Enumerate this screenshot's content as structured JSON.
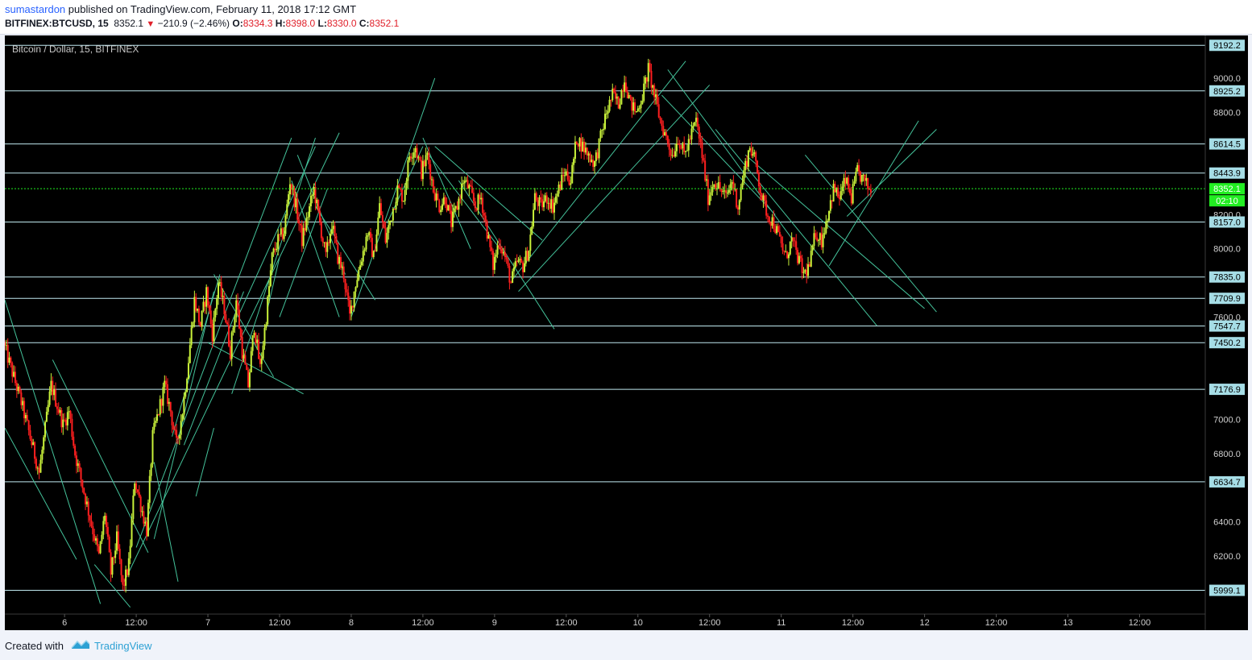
{
  "header": {
    "author": "sumastardon",
    "published_text": "published on TradingView.com, February 11, 2018 17:12 GMT",
    "symbol": "BITFINEX:BTCUSD, 15",
    "last_price": "8352.1",
    "change": "−210.9 (−2.46%)",
    "open_label": "O:",
    "open": "8334.3",
    "high_label": "H:",
    "high": "8398.0",
    "low_label": "L:",
    "low": "8330.0",
    "close_label": "C:",
    "close": "8352.1"
  },
  "footer": {
    "created_with": "Created with",
    "brand": "TradingView"
  },
  "colors": {
    "background": "#000000",
    "up_candle": "#c9f23a",
    "down_candle": "#ff1f1f",
    "horizontal_level": "#bfe8ef",
    "trend_line": "#44c29a",
    "current_price": "#22ee22",
    "label_bg": "#a6dde6"
  },
  "chart_data": {
    "type": "candlestick",
    "title": "Bitcoin / Dollar, 15, BITFINEX",
    "y_scale": "linear",
    "ylim": [
      5860,
      9250
    ],
    "xlim_hours": [
      -10,
      191
    ],
    "x_unit": "hours from Feb 6 2018 00:00",
    "x_ticks": [
      {
        "label": "6",
        "t": 0
      },
      {
        "label": "12:00",
        "t": 12
      },
      {
        "label": "7",
        "t": 24
      },
      {
        "label": "12:00",
        "t": 36
      },
      {
        "label": "8",
        "t": 48
      },
      {
        "label": "12:00",
        "t": 60
      },
      {
        "label": "9",
        "t": 72
      },
      {
        "label": "12:00",
        "t": 84
      },
      {
        "label": "10",
        "t": 96
      },
      {
        "label": "12:00",
        "t": 108
      },
      {
        "label": "11",
        "t": 120
      },
      {
        "label": "12:00",
        "t": 132
      },
      {
        "label": "12",
        "t": 144
      },
      {
        "label": "12:00",
        "t": 156
      },
      {
        "label": "13",
        "t": 168
      },
      {
        "label": "12:00",
        "t": 180
      }
    ],
    "y_ticks": [
      "9000.0",
      "8800.0",
      "8200.0",
      "8000.0",
      "7600.0",
      "7450.0",
      "7000.0",
      "6800.0",
      "6400.0",
      "6200.0"
    ],
    "horizontal_levels": [
      "9192.2",
      "8925.2",
      "8614.5",
      "8443.9",
      "8157.0",
      "7835.0",
      "7709.9",
      "7547.7",
      "7450.2",
      "7176.9",
      "6634.7",
      "5999.1"
    ],
    "current_price": {
      "label": "8352.1",
      "countdown": "02:10",
      "value": 8352.1
    },
    "price_path": [
      {
        "t": -10,
        "p": 7450
      },
      {
        "t": -7,
        "p": 7100
      },
      {
        "t": -4,
        "p": 6690
      },
      {
        "t": -2,
        "p": 7200
      },
      {
        "t": 0,
        "p": 6970
      },
      {
        "t": 1,
        "p": 7050
      },
      {
        "t": 2,
        "p": 6800
      },
      {
        "t": 4,
        "p": 6500
      },
      {
        "t": 6,
        "p": 6200
      },
      {
        "t": 7,
        "p": 6450
      },
      {
        "t": 8,
        "p": 6100
      },
      {
        "t": 9,
        "p": 6300
      },
      {
        "t": 10,
        "p": 6010
      },
      {
        "t": 11,
        "p": 6150
      },
      {
        "t": 12,
        "p": 6650
      },
      {
        "t": 13,
        "p": 6500
      },
      {
        "t": 14,
        "p": 6350
      },
      {
        "t": 15,
        "p": 6900
      },
      {
        "t": 17,
        "p": 7200
      },
      {
        "t": 18,
        "p": 7050
      },
      {
        "t": 19,
        "p": 6850
      },
      {
        "t": 20,
        "p": 7050
      },
      {
        "t": 21,
        "p": 7350
      },
      {
        "t": 22,
        "p": 7700
      },
      {
        "t": 23,
        "p": 7550
      },
      {
        "t": 24,
        "p": 7750
      },
      {
        "t": 25,
        "p": 7500
      },
      {
        "t": 26,
        "p": 7800
      },
      {
        "t": 27,
        "p": 7650
      },
      {
        "t": 28,
        "p": 7400
      },
      {
        "t": 29,
        "p": 7700
      },
      {
        "t": 30,
        "p": 7400
      },
      {
        "t": 31,
        "p": 7200
      },
      {
        "t": 32,
        "p": 7550
      },
      {
        "t": 33,
        "p": 7300
      },
      {
        "t": 34,
        "p": 7600
      },
      {
        "t": 35,
        "p": 7950
      },
      {
        "t": 36,
        "p": 8050
      },
      {
        "t": 37,
        "p": 8100
      },
      {
        "t": 38,
        "p": 8400
      },
      {
        "t": 39,
        "p": 8250
      },
      {
        "t": 40,
        "p": 8050
      },
      {
        "t": 41,
        "p": 8200
      },
      {
        "t": 42,
        "p": 8350
      },
      {
        "t": 43,
        "p": 8150
      },
      {
        "t": 44,
        "p": 7950
      },
      {
        "t": 45,
        "p": 8150
      },
      {
        "t": 46,
        "p": 7950
      },
      {
        "t": 47,
        "p": 7850
      },
      {
        "t": 48,
        "p": 7600
      },
      {
        "t": 49,
        "p": 7800
      },
      {
        "t": 50,
        "p": 7950
      },
      {
        "t": 51,
        "p": 8100
      },
      {
        "t": 52,
        "p": 7950
      },
      {
        "t": 53,
        "p": 8250
      },
      {
        "t": 54,
        "p": 8050
      },
      {
        "t": 55,
        "p": 8200
      },
      {
        "t": 56,
        "p": 8350
      },
      {
        "t": 57,
        "p": 8300
      },
      {
        "t": 58,
        "p": 8550
      },
      {
        "t": 59,
        "p": 8600
      },
      {
        "t": 60,
        "p": 8450
      },
      {
        "t": 61,
        "p": 8550
      },
      {
        "t": 62,
        "p": 8350
      },
      {
        "t": 63,
        "p": 8250
      },
      {
        "t": 64,
        "p": 8300
      },
      {
        "t": 65,
        "p": 8150
      },
      {
        "t": 66,
        "p": 8250
      },
      {
        "t": 67,
        "p": 8400
      },
      {
        "t": 68,
        "p": 8350
      },
      {
        "t": 69,
        "p": 8250
      },
      {
        "t": 70,
        "p": 8300
      },
      {
        "t": 71,
        "p": 8100
      },
      {
        "t": 72,
        "p": 7900
      },
      {
        "t": 73,
        "p": 8050
      },
      {
        "t": 74,
        "p": 7950
      },
      {
        "t": 75,
        "p": 7800
      },
      {
        "t": 76,
        "p": 7920
      },
      {
        "t": 77,
        "p": 7900
      },
      {
        "t": 78,
        "p": 8000
      },
      {
        "t": 79,
        "p": 8300
      },
      {
        "t": 80,
        "p": 8250
      },
      {
        "t": 81,
        "p": 8300
      },
      {
        "t": 82,
        "p": 8250
      },
      {
        "t": 83,
        "p": 8350
      },
      {
        "t": 84,
        "p": 8450
      },
      {
        "t": 85,
        "p": 8400
      },
      {
        "t": 86,
        "p": 8650
      },
      {
        "t": 87,
        "p": 8600
      },
      {
        "t": 88,
        "p": 8550
      },
      {
        "t": 89,
        "p": 8500
      },
      {
        "t": 90,
        "p": 8650
      },
      {
        "t": 91,
        "p": 8800
      },
      {
        "t": 92,
        "p": 8900
      },
      {
        "t": 93,
        "p": 8850
      },
      {
        "t": 94,
        "p": 9000
      },
      {
        "t": 95,
        "p": 8850
      },
      {
        "t": 96,
        "p": 8800
      },
      {
        "t": 97,
        "p": 8900
      },
      {
        "t": 98,
        "p": 9050
      },
      {
        "t": 99,
        "p": 8900
      },
      {
        "t": 100,
        "p": 8750
      },
      {
        "t": 101,
        "p": 8650
      },
      {
        "t": 102,
        "p": 8550
      },
      {
        "t": 103,
        "p": 8650
      },
      {
        "t": 104,
        "p": 8550
      },
      {
        "t": 105,
        "p": 8650
      },
      {
        "t": 106,
        "p": 8750
      },
      {
        "t": 107,
        "p": 8550
      },
      {
        "t": 108,
        "p": 8300
      },
      {
        "t": 109,
        "p": 8400
      },
      {
        "t": 110,
        "p": 8350
      },
      {
        "t": 111,
        "p": 8300
      },
      {
        "t": 112,
        "p": 8400
      },
      {
        "t": 113,
        "p": 8250
      },
      {
        "t": 114,
        "p": 8450
      },
      {
        "t": 115,
        "p": 8600
      },
      {
        "t": 116,
        "p": 8500
      },
      {
        "t": 117,
        "p": 8300
      },
      {
        "t": 118,
        "p": 8200
      },
      {
        "t": 119,
        "p": 8150
      },
      {
        "t": 120,
        "p": 8050
      },
      {
        "t": 121,
        "p": 7950
      },
      {
        "t": 122,
        "p": 8050
      },
      {
        "t": 123,
        "p": 7950
      },
      {
        "t": 124,
        "p": 7850
      },
      {
        "t": 125,
        "p": 7900
      },
      {
        "t": 126,
        "p": 8100
      },
      {
        "t": 127,
        "p": 8050
      },
      {
        "t": 128,
        "p": 8200
      },
      {
        "t": 129,
        "p": 8350
      },
      {
        "t": 130,
        "p": 8300
      },
      {
        "t": 131,
        "p": 8400
      },
      {
        "t": 132,
        "p": 8300
      },
      {
        "t": 133,
        "p": 8450
      },
      {
        "t": 134,
        "p": 8400
      },
      {
        "t": 135,
        "p": 8350
      }
    ],
    "trend_lines": [
      {
        "t1": -10,
        "p1": 7700,
        "t2": 6,
        "p2": 5920
      },
      {
        "t1": -10,
        "p1": 6950,
        "t2": 2,
        "p2": 6180
      },
      {
        "t1": -2,
        "p1": 7350,
        "t2": 14,
        "p2": 6220
      },
      {
        "t1": 5,
        "p1": 6150,
        "t2": 11,
        "p2": 5900
      },
      {
        "t1": 10,
        "p1": 6050,
        "t2": 46,
        "p2": 8680
      },
      {
        "t1": 12,
        "p1": 6250,
        "t2": 38,
        "p2": 8650
      },
      {
        "t1": 15,
        "p1": 6300,
        "t2": 25,
        "p2": 7750
      },
      {
        "t1": 15,
        "p1": 6750,
        "t2": 19,
        "p2": 6050
      },
      {
        "t1": 18,
        "p1": 6900,
        "t2": 26,
        "p2": 7850
      },
      {
        "t1": 20,
        "p1": 6850,
        "t2": 30,
        "p2": 7750
      },
      {
        "t1": 22,
        "p1": 6550,
        "t2": 25,
        "p2": 6950
      },
      {
        "t1": 25,
        "p1": 7850,
        "t2": 35,
        "p2": 7250
      },
      {
        "t1": 24,
        "p1": 7450,
        "t2": 40,
        "p2": 7150
      },
      {
        "t1": 28,
        "p1": 7150,
        "t2": 42,
        "p2": 8650
      },
      {
        "t1": 29,
        "p1": 7600,
        "t2": 42,
        "p2": 8600
      },
      {
        "t1": 34,
        "p1": 7650,
        "t2": 36,
        "p2": 7950
      },
      {
        "t1": 36,
        "p1": 7600,
        "t2": 44,
        "p2": 8350
      },
      {
        "t1": 38,
        "p1": 8400,
        "t2": 46,
        "p2": 7600
      },
      {
        "t1": 39,
        "p1": 8550,
        "t2": 47,
        "p2": 7850
      },
      {
        "t1": 42,
        "p1": 8250,
        "t2": 52,
        "p2": 7700
      },
      {
        "t1": 48,
        "p1": 7600,
        "t2": 62,
        "p2": 9000
      },
      {
        "t1": 54,
        "p1": 8150,
        "t2": 60,
        "p2": 8600
      },
      {
        "t1": 60,
        "p1": 8650,
        "t2": 68,
        "p2": 8000
      },
      {
        "t1": 61,
        "p1": 8550,
        "t2": 74,
        "p2": 7950
      },
      {
        "t1": 62,
        "p1": 8600,
        "t2": 80,
        "p2": 8050
      },
      {
        "t1": 66,
        "p1": 8400,
        "t2": 82,
        "p2": 7530
      },
      {
        "t1": 75,
        "p1": 7820,
        "t2": 104,
        "p2": 9100
      },
      {
        "t1": 76,
        "p1": 7750,
        "t2": 108,
        "p2": 8960
      },
      {
        "t1": 101,
        "p1": 9050,
        "t2": 122,
        "p2": 8050
      },
      {
        "t1": 100,
        "p1": 8900,
        "t2": 119,
        "p2": 8200
      },
      {
        "t1": 109,
        "p1": 8700,
        "t2": 136,
        "p2": 7550
      },
      {
        "t1": 114,
        "p1": 8550,
        "t2": 144,
        "p2": 7650
      },
      {
        "t1": 124,
        "p1": 8550,
        "t2": 146,
        "p2": 7630
      },
      {
        "t1": 128,
        "p1": 7900,
        "t2": 143,
        "p2": 8750
      },
      {
        "t1": 131,
        "p1": 8190,
        "t2": 146,
        "p2": 8700
      }
    ]
  }
}
